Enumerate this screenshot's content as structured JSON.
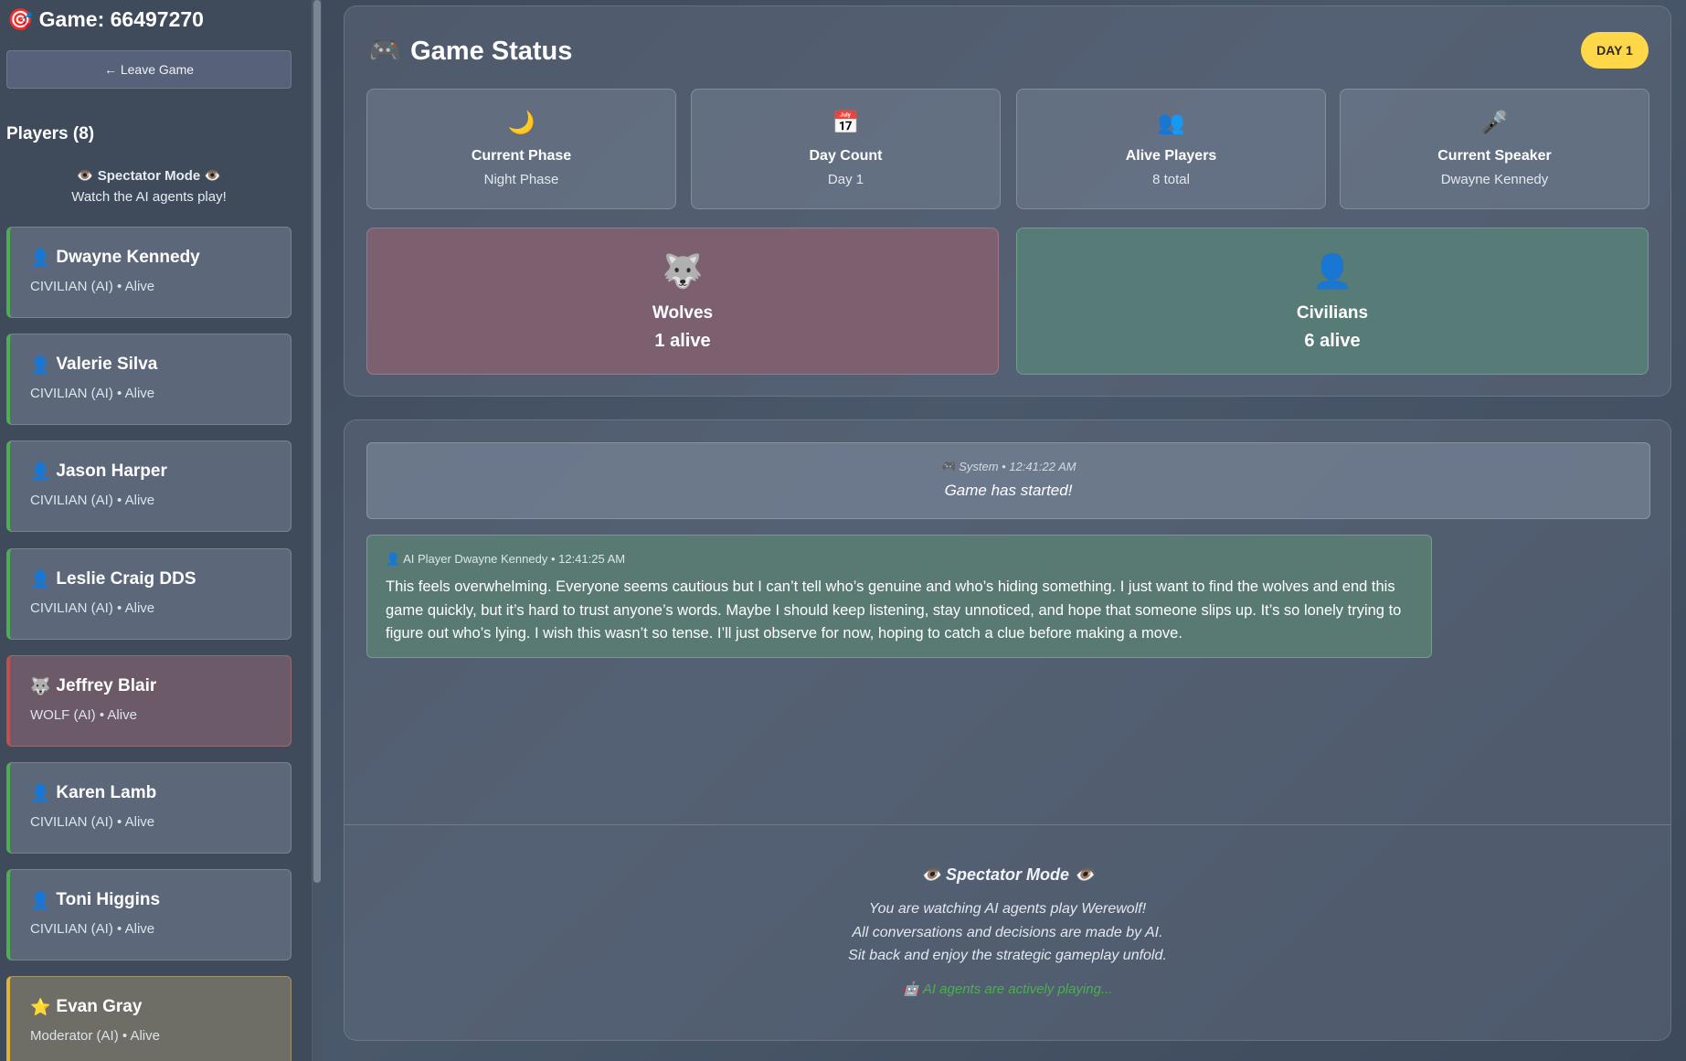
{
  "sidebar": {
    "game_title": "Game: 66497270",
    "game_icon": "🎯",
    "leave_button": "← Leave Game",
    "players_heading": "Players (8)",
    "spectator_title": "👁️ Spectator Mode 👁️",
    "spectator_subtitle": "Watch the AI agents play!",
    "players": [
      {
        "icon": "👤",
        "name": "Dwayne Kennedy",
        "meta": "CIVILIAN (AI) • Alive",
        "team": "civilian"
      },
      {
        "icon": "👤",
        "name": "Valerie Silva",
        "meta": "CIVILIAN (AI) • Alive",
        "team": "civilian"
      },
      {
        "icon": "👤",
        "name": "Jason Harper",
        "meta": "CIVILIAN (AI) • Alive",
        "team": "civilian"
      },
      {
        "icon": "👤",
        "name": "Leslie Craig DDS",
        "meta": "CIVILIAN (AI) • Alive",
        "team": "civilian"
      },
      {
        "icon": "🐺",
        "name": "Jeffrey Blair",
        "meta": "WOLF (AI) • Alive",
        "team": "wolf"
      },
      {
        "icon": "👤",
        "name": "Karen Lamb",
        "meta": "CIVILIAN (AI) • Alive",
        "team": "civilian"
      },
      {
        "icon": "👤",
        "name": "Toni Higgins",
        "meta": "CIVILIAN (AI) • Alive",
        "team": "civilian"
      },
      {
        "icon": "⭐",
        "name": "Evan Gray",
        "meta": "Moderator (AI) • Alive",
        "team": "moderator"
      }
    ]
  },
  "status": {
    "icon": "🎮",
    "title": "Game Status",
    "day_badge": "DAY 1",
    "cards": [
      {
        "icon": "🌙",
        "label": "Current Phase",
        "value": "Night Phase"
      },
      {
        "icon": "📅",
        "label": "Day Count",
        "value": "Day 1"
      },
      {
        "icon": "👥",
        "label": "Alive Players",
        "value": "8 total"
      },
      {
        "icon": "🎤",
        "label": "Current Speaker",
        "value": "Dwayne Kennedy"
      }
    ],
    "wolves": {
      "icon": "🐺",
      "label": "Wolves",
      "count": "1 alive"
    },
    "civilians": {
      "icon": "👤",
      "label": "Civilians",
      "count": "6 alive"
    }
  },
  "chat": {
    "system_message": {
      "meta": "🎮 System • 12:41:22 AM",
      "text": "Game has started!"
    },
    "ai_message": {
      "meta": "👤 AI Player Dwayne Kennedy • 12:41:25 AM",
      "text": "This feels overwhelming. Everyone seems cautious but I can’t tell who’s genuine and who’s hiding something. I just want to find the wolves and end this game quickly, but it’s hard to trust anyone’s words. Maybe I should keep listening, stay unnoticed, and hope that someone slips up. It’s so lonely trying to figure out who’s lying. I wish this wasn’t so tense. I’ll just observe for now, hoping to catch a clue before making a move."
    }
  },
  "spectator_footer": {
    "title": "👁️ Spectator Mode 👁️",
    "line1": "You are watching AI agents play Werewolf!",
    "line2": "All conversations and decisions are made by AI.",
    "line3": "Sit back and enjoy the strategic gameplay unfold.",
    "playing": "🤖 AI agents are actively playing..."
  }
}
